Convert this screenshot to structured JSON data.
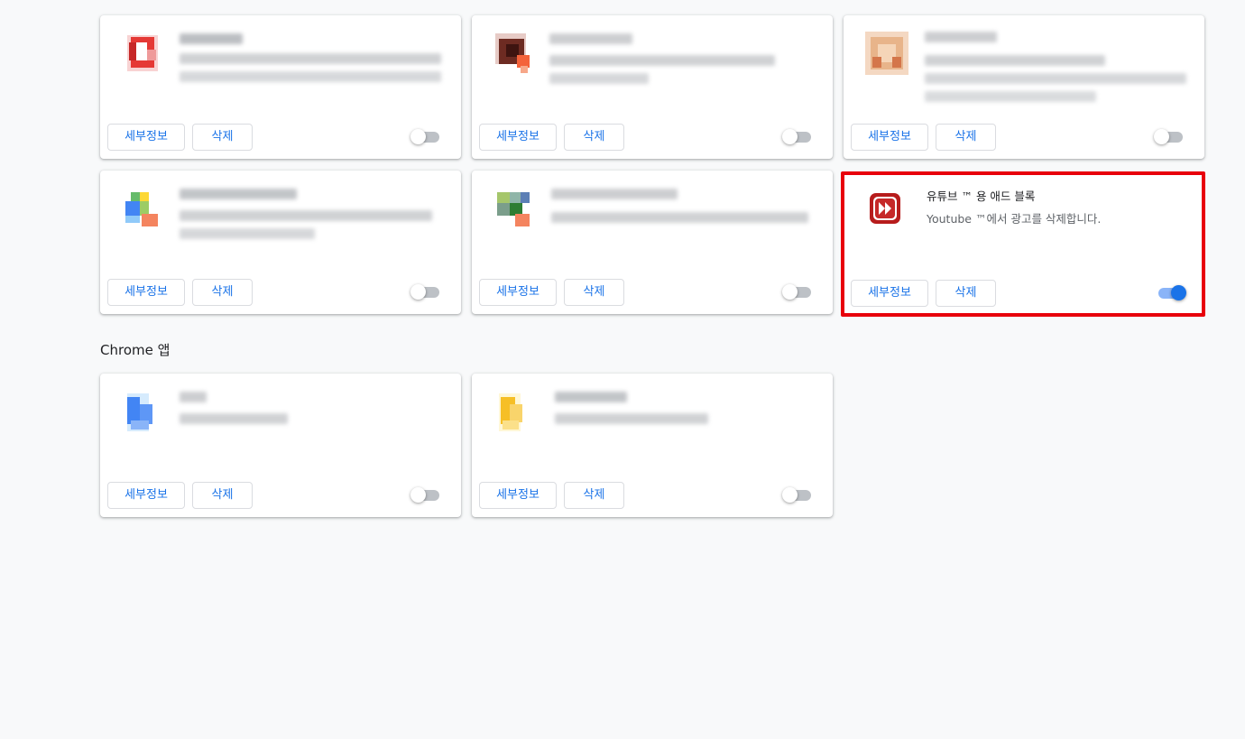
{
  "buttons": {
    "details_label": "세부정보",
    "remove_label": "삭제"
  },
  "extensions": [
    {
      "name": "",
      "description": "",
      "icon": "red-extension-icon",
      "enabled": false,
      "blurred": true
    },
    {
      "name": "",
      "description": "",
      "icon": "brown-extension-icon",
      "enabled": false,
      "blurred": true
    },
    {
      "name": "",
      "description": "",
      "icon": "tan-extension-icon",
      "enabled": false,
      "blurred": true
    },
    {
      "name": "",
      "description": "",
      "icon": "multicolor-extension-icon",
      "enabled": false,
      "blurred": true
    },
    {
      "name": "",
      "description": "",
      "icon": "green-extension-icon",
      "enabled": false,
      "blurred": true
    },
    {
      "name": "유튜브 ™ 용 애드 블록",
      "description": "Youtube ™에서 광고를 삭제합니다.",
      "icon": "fast-forward-icon",
      "enabled": true,
      "blurred": false,
      "highlighted": true
    }
  ],
  "chrome_apps_section": {
    "title": "Chrome 앱"
  },
  "apps": [
    {
      "name": "",
      "description": "",
      "icon": "blue-doc-app-icon",
      "enabled": false,
      "blurred": true
    },
    {
      "name": "",
      "description": "",
      "icon": "yellow-doc-app-icon",
      "enabled": false,
      "blurred": true
    }
  ],
  "colors": {
    "accent": "#1a73e8",
    "highlight_border": "#e8000b",
    "background": "#f8f9fa"
  }
}
